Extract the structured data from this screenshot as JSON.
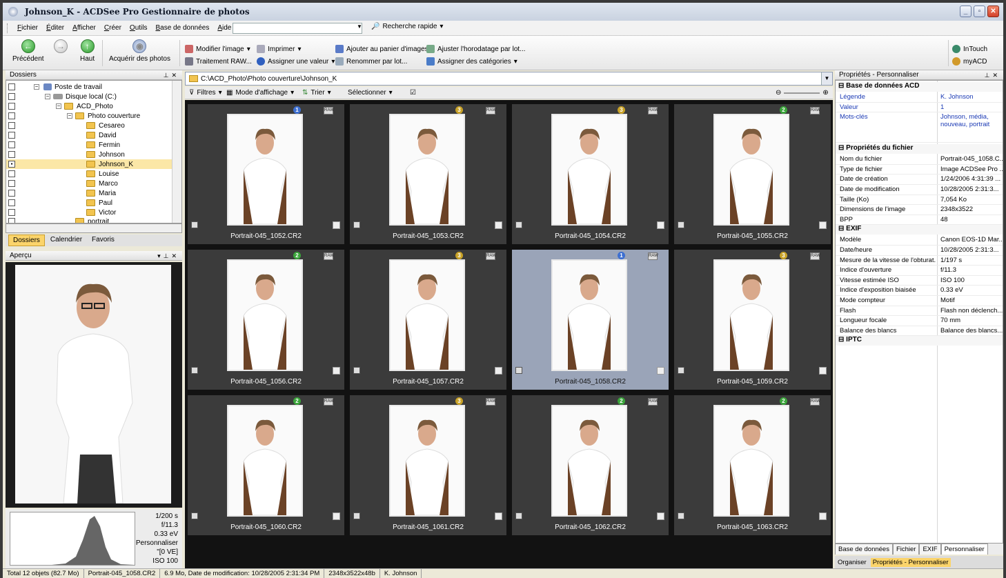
{
  "window": {
    "title": "Johnson_K - ACDSee Pro Gestionnaire de photos"
  },
  "menu": [
    "Fichier",
    "Éditer",
    "Afficher",
    "Créer",
    "Outils",
    "Base de données",
    "Aide"
  ],
  "quick_search": {
    "label": "Recherche rapide",
    "value": ""
  },
  "toolbar": {
    "back": "Précédent",
    "up": "Haut",
    "acquire": "Acquérir des photos",
    "modify": "Modifier l'image",
    "print": "Imprimer",
    "add_basket": "Ajouter au panier d'images",
    "timestamp": "Ajuster l'horodatage par lot...",
    "raw": "Traitement RAW...",
    "assign_value": "Assigner une valeur",
    "rename": "Renommer par lot...",
    "assign_cat": "Assigner des catégories",
    "intouch": "InTouch",
    "myacd": "myACD"
  },
  "folders_pane": {
    "title": "Dossiers",
    "tree": [
      "Poste de travail",
      "Disque local (C:)",
      "ACD_Photo",
      "Photo couverture",
      "Cesareo",
      "David",
      "Fermin",
      "Johnson",
      "Johnson_K",
      "Louise",
      "Marco",
      "Maria",
      "Paul",
      "Victor",
      "portrait"
    ],
    "selected": "Johnson_K",
    "tabs": [
      "Dossiers",
      "Calendrier",
      "Favoris"
    ]
  },
  "preview_pane": {
    "title": "Aperçu",
    "exif": [
      "1/200 s",
      "f/11.3",
      "0.33 eV",
      "Personnaliser",
      "\"[0 VE]",
      "ISO 100"
    ]
  },
  "address": {
    "path": "C:\\ACD_Photo\\Photo couverture\\Johnson_K"
  },
  "filter_bar": {
    "filters": "Filtres",
    "view_mode": "Mode d'affichage",
    "sort": "Trier",
    "select": "Sélectionner"
  },
  "thumbnails": [
    {
      "name": "Portrait-045_1052.CR2",
      "rating": "1",
      "color": "#3d6fd1"
    },
    {
      "name": "Portrait-045_1053.CR2",
      "rating": "3",
      "color": "#c9a227"
    },
    {
      "name": "Portrait-045_1054.CR2",
      "rating": "3",
      "color": "#c9a227"
    },
    {
      "name": "Portrait-045_1055.CR2",
      "rating": "2",
      "color": "#3aa53a"
    },
    {
      "name": "Portrait-045_1056.CR2",
      "rating": "2",
      "color": "#3aa53a"
    },
    {
      "name": "Portrait-045_1057.CR2",
      "rating": "3",
      "color": "#c9a227"
    },
    {
      "name": "Portrait-045_1058.CR2",
      "rating": "1",
      "color": "#3d6fd1"
    },
    {
      "name": "Portrait-045_1059.CR2",
      "rating": "3",
      "color": "#c9a227"
    },
    {
      "name": "Portrait-045_1060.CR2",
      "rating": "2",
      "color": "#3aa53a"
    },
    {
      "name": "Portrait-045_1061.CR2",
      "rating": "3",
      "color": "#c9a227"
    },
    {
      "name": "Portrait-045_1062.CR2",
      "rating": "2",
      "color": "#3aa53a"
    },
    {
      "name": "Portrait-045_1063.CR2",
      "rating": "2",
      "color": "#3aa53a"
    }
  ],
  "selected_thumbnail": "Portrait-045_1058.CR2",
  "properties": {
    "title": "Propriétés - Personnaliser",
    "acd_section": "Base de données ACD",
    "acd": [
      [
        "Légende",
        "K. Johnson"
      ],
      [
        "Valeur",
        "1"
      ],
      [
        "Mots-clés",
        "Johnson, média, nouveau, portrait"
      ]
    ],
    "file_section": "Propriétés du fichier",
    "file": [
      [
        "Nom du fichier",
        "Portrait-045_1058.C..."
      ],
      [
        "Type de fichier",
        "Image ACDSee Pro ..."
      ],
      [
        "Date de création",
        "1/24/2006 4:31:39 ..."
      ],
      [
        "Date de modification",
        "10/28/2005 2:31:3..."
      ],
      [
        "Taille (Ko)",
        "7,054 Ko"
      ],
      [
        "Dimensions de l'image",
        "2348x3522"
      ],
      [
        "BPP",
        "48"
      ]
    ],
    "exif_section": "EXIF",
    "exif": [
      [
        "Modèle",
        "Canon EOS-1D Mar..."
      ],
      [
        "Date/heure",
        "10/28/2005 2:31:3..."
      ],
      [
        "Mesure de la vitesse de l'obturat...",
        "1/197 s"
      ],
      [
        "Indice d'ouverture",
        "f/11.3"
      ],
      [
        "Vitesse estimée ISO",
        "ISO 100"
      ],
      [
        "Indice d'exposition biaisée",
        "0.33 eV"
      ],
      [
        "Mode compteur",
        "Motif"
      ],
      [
        "Flash",
        "Flash non déclench..."
      ],
      [
        "Longueur focale",
        "70 mm"
      ],
      [
        "Balance des blancs",
        "Balance des blancs..."
      ]
    ],
    "iptc_section": "IPTC",
    "tabs": [
      "Base de données",
      "Fichier",
      "EXIF",
      "Personnaliser"
    ],
    "tabs2": [
      "Organiser",
      "Propriétés - Personnaliser"
    ]
  },
  "status": [
    "Total 12 objets (82.7 Mo)",
    "Portrait-045_1058.CR2",
    "6.9 Mo, Date de modification: 10/28/2005 2:31:34 PM",
    "2348x3522x48b",
    "K. Johnson"
  ]
}
